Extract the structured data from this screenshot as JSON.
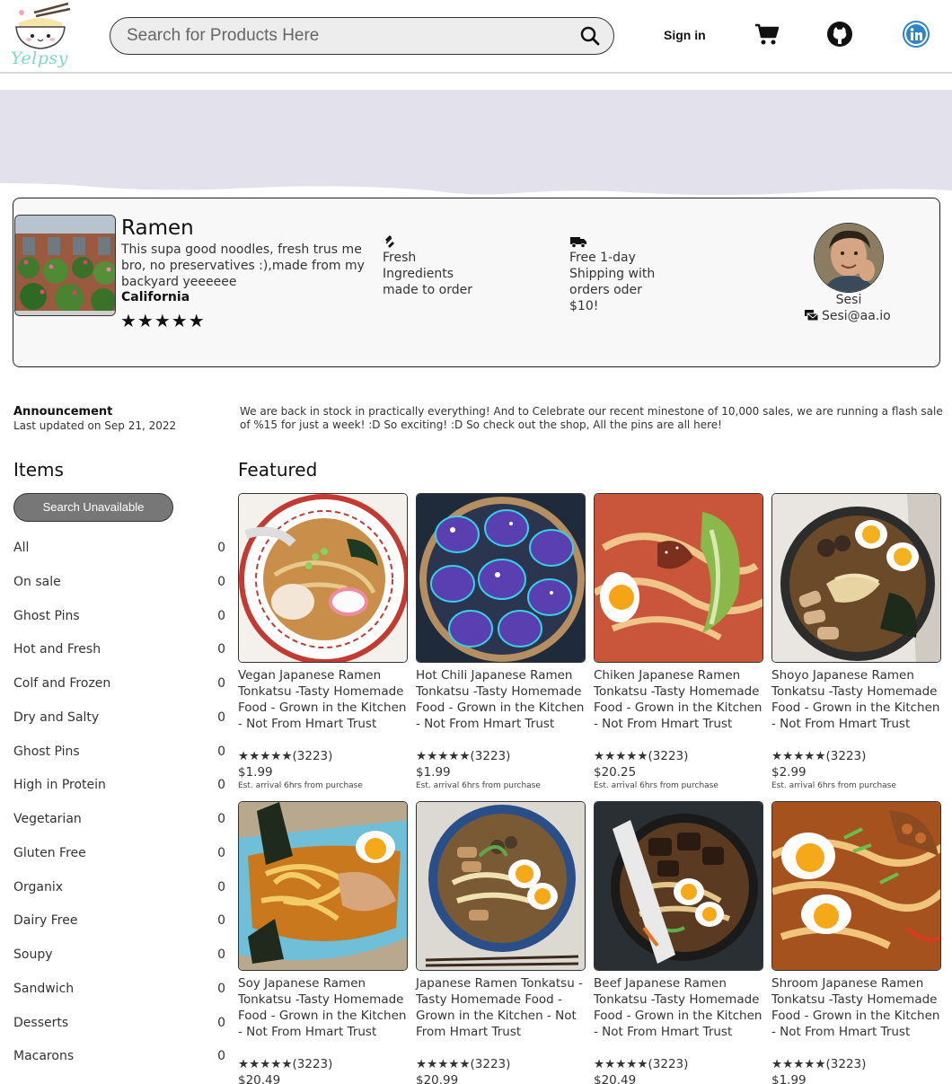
{
  "header": {
    "logo_text": "Yelpsy",
    "search_placeholder": "Search for Products Here",
    "signin_label": "Sign in",
    "icons": [
      "logo-icon",
      "search-icon",
      "cart-icon",
      "github-icon",
      "linkedin-icon"
    ]
  },
  "shop": {
    "title": "Ramen",
    "description": "This supa good noodles, fresh trus me bro, no preservatives :),made from my backyard yeeeeee",
    "location": "California",
    "stars": "★★★★★",
    "feature1": {
      "icon": "fresh-icon",
      "text": "Fresh Ingredients made to order"
    },
    "feature2": {
      "icon": "truck-icon",
      "text": "Free 1-day Shipping with orders oder $10!"
    },
    "owner_name": "Sesi",
    "owner_email": "Sesi@aa.io"
  },
  "announcement": {
    "title": "Announcement",
    "date": "Last updated on Sep 21, 2022",
    "text": "We are back in stock in practically everything! And to Celebrate our recent minestone of 10,000 sales, we are running a flash sale of %15 for just a week! :D So exciting! :D So check out the shop, All the pins are all here!"
  },
  "sidebar": {
    "title": "Items",
    "search_button": "Search Unavailable",
    "categories": [
      {
        "label": "All",
        "count": "0"
      },
      {
        "label": "On sale",
        "count": "0"
      },
      {
        "label": "Ghost Pins",
        "count": "0"
      },
      {
        "label": "Hot and Fresh",
        "count": "0"
      },
      {
        "label": "Colf and Frozen",
        "count": "0"
      },
      {
        "label": "Dry and Salty",
        "count": "0"
      },
      {
        "label": "Ghost Pins",
        "count": "0"
      },
      {
        "label": "High in Protein",
        "count": "0"
      },
      {
        "label": "Vegetarian",
        "count": "0"
      },
      {
        "label": "Gluten Free",
        "count": "0"
      },
      {
        "label": "Organix",
        "count": "0"
      },
      {
        "label": "Dairy Free",
        "count": "0"
      },
      {
        "label": "Soupy",
        "count": "0"
      },
      {
        "label": "Sandwich",
        "count": "0"
      },
      {
        "label": "Desserts",
        "count": "0"
      },
      {
        "label": "Macarons",
        "count": "0"
      }
    ]
  },
  "featured": {
    "title": "Featured",
    "products": [
      {
        "title": "Vegan Japanese Ramen Tonkatsu -Tasty Homemade Food - Grown in the Kitchen - Not From Hmart Trust",
        "rating": "★★★★★(3223)",
        "price": "$1.99",
        "arrival": "Est. arrival 6hrs from purchase"
      },
      {
        "title": "Hot Chili Japanese Ramen Tonkatsu -Tasty Homemade Food - Grown in the Kitchen - Not From Hmart Trust",
        "rating": "★★★★★(3223)",
        "price": "$1.99",
        "arrival": "Est. arrival 6hrs from purchase"
      },
      {
        "title": "Chiken Japanese Ramen Tonkatsu -Tasty Homemade Food - Grown in the Kitchen - Not From Hmart Trust",
        "rating": "★★★★★(3223)",
        "price": "$20.25",
        "arrival": "Est. arrival 6hrs from purchase"
      },
      {
        "title": "Shoyo Japanese Ramen Tonkatsu -Tasty Homemade Food - Grown in the Kitchen - Not From Hmart Trust",
        "rating": "★★★★★(3223)",
        "price": "$2.99",
        "arrival": "Est. arrival 6hrs from purchase"
      },
      {
        "title": "Soy Japanese Ramen Tonkatsu -Tasty Homemade Food - Grown in the Kitchen - Not From Hmart Trust",
        "rating": "★★★★★(3223)",
        "price": "$20.49",
        "arrival": ""
      },
      {
        "title": "Japanese Ramen Tonkatsu -Tasty Homemade Food - Grown in the Kitchen - Not From Hmart Trust",
        "rating": "★★★★★(3223)",
        "price": "$20.99",
        "arrival": ""
      },
      {
        "title": "Beef Japanese Ramen Tonkatsu -Tasty Homemade Food - Grown in the Kitchen - Not From Hmart Trust",
        "rating": "★★★★★(3223)",
        "price": "$20.49",
        "arrival": ""
      },
      {
        "title": "Shroom Japanese Ramen Tonkatsu -Tasty Homemade Food - Grown in the Kitchen - Not From Hmart Trust",
        "rating": "★★★★★(3223)",
        "price": "$1.99",
        "arrival": ""
      }
    ]
  },
  "colors": {
    "banner": "#e3e2ec",
    "logo_text": "#7fd8c6",
    "linkedin": "#2d84c8",
    "button": "#777777"
  }
}
